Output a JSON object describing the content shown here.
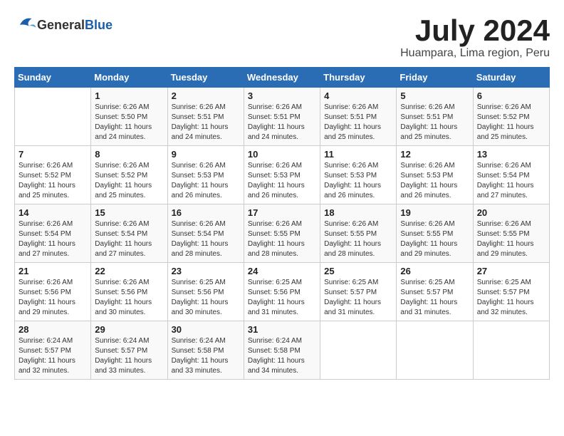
{
  "logo": {
    "general": "General",
    "blue": "Blue"
  },
  "title": "July 2024",
  "location": "Huampara, Lima region, Peru",
  "days_of_week": [
    "Sunday",
    "Monday",
    "Tuesday",
    "Wednesday",
    "Thursday",
    "Friday",
    "Saturday"
  ],
  "weeks": [
    [
      {
        "day": "",
        "info": ""
      },
      {
        "day": "1",
        "info": "Sunrise: 6:26 AM\nSunset: 5:50 PM\nDaylight: 11 hours\nand 24 minutes."
      },
      {
        "day": "2",
        "info": "Sunrise: 6:26 AM\nSunset: 5:51 PM\nDaylight: 11 hours\nand 24 minutes."
      },
      {
        "day": "3",
        "info": "Sunrise: 6:26 AM\nSunset: 5:51 PM\nDaylight: 11 hours\nand 24 minutes."
      },
      {
        "day": "4",
        "info": "Sunrise: 6:26 AM\nSunset: 5:51 PM\nDaylight: 11 hours\nand 25 minutes."
      },
      {
        "day": "5",
        "info": "Sunrise: 6:26 AM\nSunset: 5:51 PM\nDaylight: 11 hours\nand 25 minutes."
      },
      {
        "day": "6",
        "info": "Sunrise: 6:26 AM\nSunset: 5:52 PM\nDaylight: 11 hours\nand 25 minutes."
      }
    ],
    [
      {
        "day": "7",
        "info": "Sunrise: 6:26 AM\nSunset: 5:52 PM\nDaylight: 11 hours\nand 25 minutes."
      },
      {
        "day": "8",
        "info": "Sunrise: 6:26 AM\nSunset: 5:52 PM\nDaylight: 11 hours\nand 25 minutes."
      },
      {
        "day": "9",
        "info": "Sunrise: 6:26 AM\nSunset: 5:53 PM\nDaylight: 11 hours\nand 26 minutes."
      },
      {
        "day": "10",
        "info": "Sunrise: 6:26 AM\nSunset: 5:53 PM\nDaylight: 11 hours\nand 26 minutes."
      },
      {
        "day": "11",
        "info": "Sunrise: 6:26 AM\nSunset: 5:53 PM\nDaylight: 11 hours\nand 26 minutes."
      },
      {
        "day": "12",
        "info": "Sunrise: 6:26 AM\nSunset: 5:53 PM\nDaylight: 11 hours\nand 26 minutes."
      },
      {
        "day": "13",
        "info": "Sunrise: 6:26 AM\nSunset: 5:54 PM\nDaylight: 11 hours\nand 27 minutes."
      }
    ],
    [
      {
        "day": "14",
        "info": "Sunrise: 6:26 AM\nSunset: 5:54 PM\nDaylight: 11 hours\nand 27 minutes."
      },
      {
        "day": "15",
        "info": "Sunrise: 6:26 AM\nSunset: 5:54 PM\nDaylight: 11 hours\nand 27 minutes."
      },
      {
        "day": "16",
        "info": "Sunrise: 6:26 AM\nSunset: 5:54 PM\nDaylight: 11 hours\nand 28 minutes."
      },
      {
        "day": "17",
        "info": "Sunrise: 6:26 AM\nSunset: 5:55 PM\nDaylight: 11 hours\nand 28 minutes."
      },
      {
        "day": "18",
        "info": "Sunrise: 6:26 AM\nSunset: 5:55 PM\nDaylight: 11 hours\nand 28 minutes."
      },
      {
        "day": "19",
        "info": "Sunrise: 6:26 AM\nSunset: 5:55 PM\nDaylight: 11 hours\nand 29 minutes."
      },
      {
        "day": "20",
        "info": "Sunrise: 6:26 AM\nSunset: 5:55 PM\nDaylight: 11 hours\nand 29 minutes."
      }
    ],
    [
      {
        "day": "21",
        "info": "Sunrise: 6:26 AM\nSunset: 5:56 PM\nDaylight: 11 hours\nand 29 minutes."
      },
      {
        "day": "22",
        "info": "Sunrise: 6:26 AM\nSunset: 5:56 PM\nDaylight: 11 hours\nand 30 minutes."
      },
      {
        "day": "23",
        "info": "Sunrise: 6:25 AM\nSunset: 5:56 PM\nDaylight: 11 hours\nand 30 minutes."
      },
      {
        "day": "24",
        "info": "Sunrise: 6:25 AM\nSunset: 5:56 PM\nDaylight: 11 hours\nand 31 minutes."
      },
      {
        "day": "25",
        "info": "Sunrise: 6:25 AM\nSunset: 5:57 PM\nDaylight: 11 hours\nand 31 minutes."
      },
      {
        "day": "26",
        "info": "Sunrise: 6:25 AM\nSunset: 5:57 PM\nDaylight: 11 hours\nand 31 minutes."
      },
      {
        "day": "27",
        "info": "Sunrise: 6:25 AM\nSunset: 5:57 PM\nDaylight: 11 hours\nand 32 minutes."
      }
    ],
    [
      {
        "day": "28",
        "info": "Sunrise: 6:24 AM\nSunset: 5:57 PM\nDaylight: 11 hours\nand 32 minutes."
      },
      {
        "day": "29",
        "info": "Sunrise: 6:24 AM\nSunset: 5:57 PM\nDaylight: 11 hours\nand 33 minutes."
      },
      {
        "day": "30",
        "info": "Sunrise: 6:24 AM\nSunset: 5:58 PM\nDaylight: 11 hours\nand 33 minutes."
      },
      {
        "day": "31",
        "info": "Sunrise: 6:24 AM\nSunset: 5:58 PM\nDaylight: 11 hours\nand 34 minutes."
      },
      {
        "day": "",
        "info": ""
      },
      {
        "day": "",
        "info": ""
      },
      {
        "day": "",
        "info": ""
      }
    ]
  ]
}
